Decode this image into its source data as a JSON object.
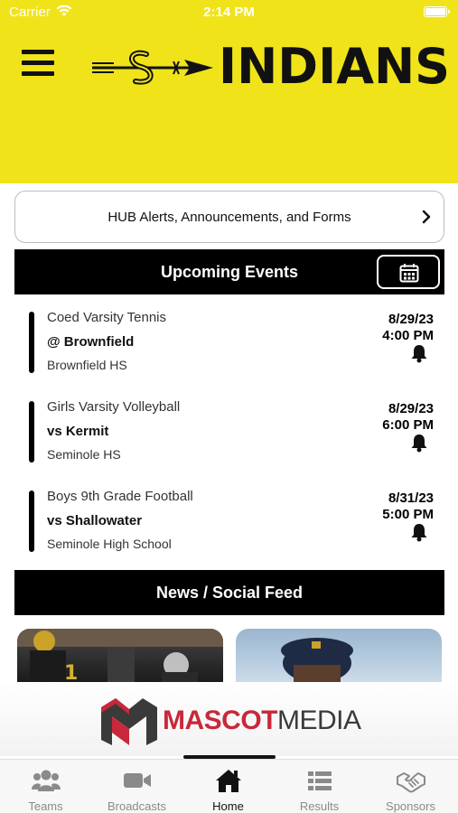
{
  "status_bar": {
    "carrier": "Carrier",
    "time": "2:14 PM"
  },
  "header": {
    "logo_text": "INDIANS",
    "background_color": "#f0e31a",
    "menu_icon": "hamburger-icon"
  },
  "alerts": {
    "label": "HUB Alerts, Announcements, and Forms",
    "icon": "chevron-right-icon"
  },
  "events": {
    "title": "Upcoming Events",
    "calendar_icon": "calendar-icon",
    "items": [
      {
        "sport": "Coed Varsity Tennis",
        "opponent": "@ Brownfield",
        "location": "Brownfield HS",
        "date": "8/29/23",
        "time": "4:00 PM"
      },
      {
        "sport": "Girls Varsity Volleyball",
        "opponent": "vs Kermit",
        "location": "Seminole HS",
        "date": "8/29/23",
        "time": "6:00 PM"
      },
      {
        "sport": "Boys 9th Grade Football",
        "opponent": "vs Shallowater",
        "location": "Seminole High School",
        "date": "8/31/23",
        "time": "5:00 PM"
      }
    ]
  },
  "news": {
    "title": "News / Social Feed"
  },
  "sponsor": {
    "name_part1": "MASCOT",
    "name_part2": "MEDIA",
    "accent_color": "#c8283a"
  },
  "tabs": [
    {
      "label": "Teams",
      "icon": "teams-icon",
      "active": false
    },
    {
      "label": "Broadcasts",
      "icon": "video-camera-icon",
      "active": false
    },
    {
      "label": "Home",
      "icon": "home-icon",
      "active": true
    },
    {
      "label": "Results",
      "icon": "list-icon",
      "active": false
    },
    {
      "label": "Sponsors",
      "icon": "handshake-icon",
      "active": false
    }
  ]
}
